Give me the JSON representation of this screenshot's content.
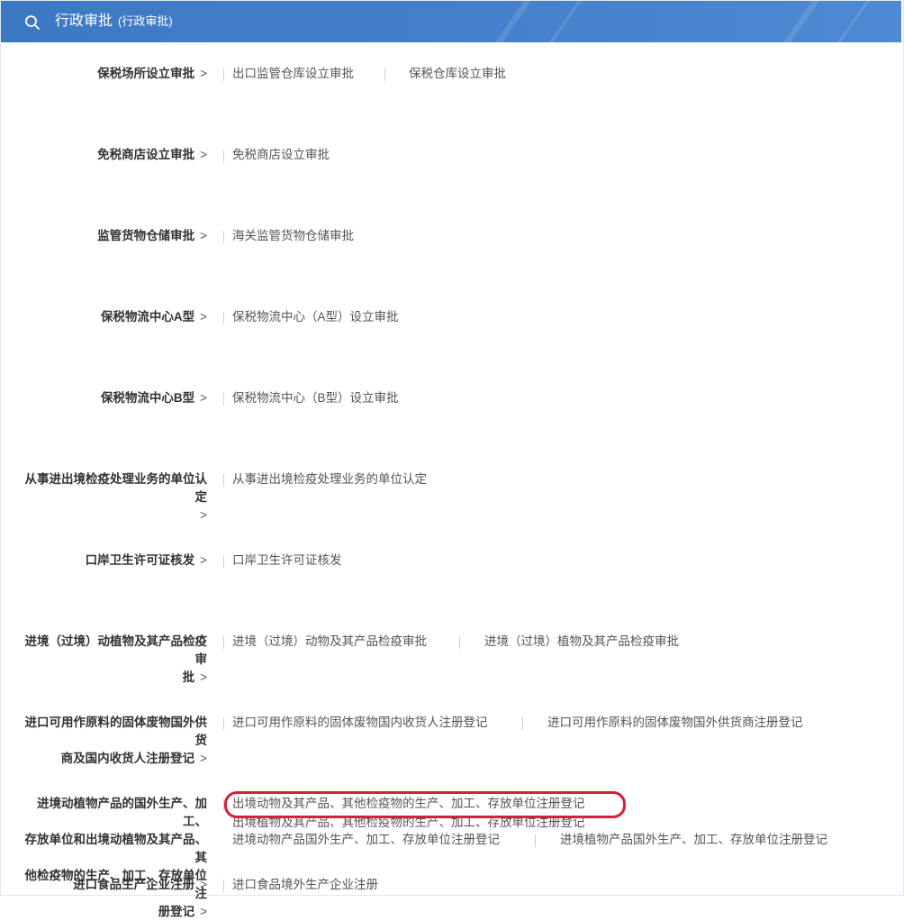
{
  "header": {
    "title": "行政审批",
    "subtitle": "(行政审批)",
    "icon": "search-icon",
    "background": "#4680cc"
  },
  "arrow": ">",
  "highlight_color": "#d6203a",
  "categories": [
    {
      "label": "保税场所设立审批",
      "items": [
        "出口监管仓库设立审批",
        "保税仓库设立审批"
      ]
    },
    {
      "label": "免税商店设立审批",
      "items": [
        "免税商店设立审批"
      ]
    },
    {
      "label": "监管货物仓储审批",
      "items": [
        "海关监管货物仓储审批"
      ]
    },
    {
      "label": "保税物流中心A型",
      "items": [
        "保税物流中心（A型）设立审批"
      ]
    },
    {
      "label": "保税物流中心B型",
      "items": [
        "保税物流中心（B型）设立审批"
      ]
    },
    {
      "label_lines": [
        "从事进出境检疫处理业务的单位认定"
      ],
      "items": [
        "从事进出境检疫处理业务的单位认定"
      ]
    },
    {
      "label": "口岸卫生许可证核发",
      "items": [
        "口岸卫生许可证核发"
      ]
    },
    {
      "label_lines": [
        "进境（过境）动植物及其产品检疫审",
        "批"
      ],
      "items": [
        "进境（过境）动物及其产品检疫审批",
        "进境（过境）植物及其产品检疫审批"
      ]
    },
    {
      "label_lines": [
        "进口可用作原料的固体废物国外供货",
        "商及国内收货人注册登记"
      ],
      "items": [
        "进口可用作原料的固体废物国内收货人注册登记",
        "进口可用作原料的固体废物国外供货商注册登记"
      ]
    },
    {
      "label_lines": [
        "进境动植物产品的国外生产、加工、",
        "存放单位和出境动植物及其产品、其",
        "他检疫物的生产、加工、存放单位注",
        "册登记"
      ],
      "items": [
        "出境动物及其产品、其他检疫物的生产、加工、存放单位注册登记",
        "出境植物及其产品、其他检疫物的生产、加工、存放单位注册登记",
        "进境动物产品国外生产、加工、存放单位注册登记",
        "进境植物产品国外生产、加工、存放单位注册登记"
      ]
    },
    {
      "label": "进口食品生产企业注册",
      "items": [
        "进口食品境外生产企业注册"
      ]
    }
  ]
}
